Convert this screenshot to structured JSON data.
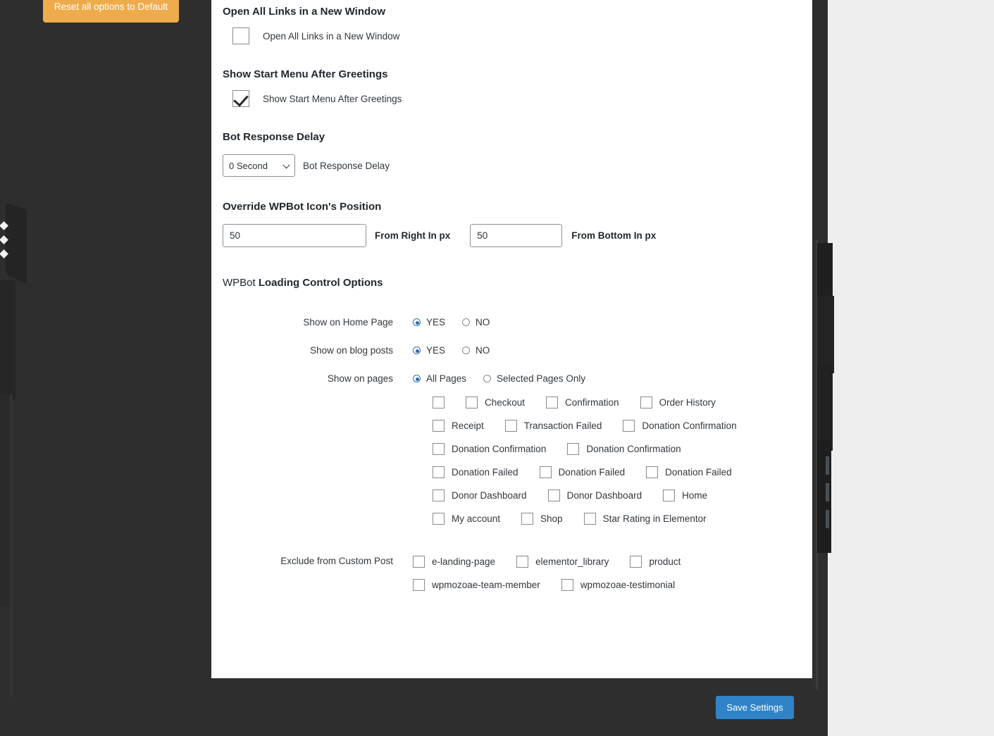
{
  "buttons": {
    "reset_label": "Reset all options to Default",
    "save_label": "Save Settings",
    "reset_color": "#eeab4b",
    "save_color": "#3183c8"
  },
  "sections": {
    "open_links": {
      "heading": "Open All Links in a New Window",
      "checkbox_label": "Open All Links in a New Window",
      "checked": false
    },
    "start_menu": {
      "heading": "Show Start Menu After Greetings",
      "checkbox_label": "Show Start Menu After Greetings",
      "checked": true
    },
    "bot_delay": {
      "heading": "Bot Response Delay",
      "selected_value": "0 Second",
      "after_label": "Bot Response Delay"
    },
    "icon_position": {
      "heading": "Override WPBot Icon's Position",
      "right_value": "50",
      "right_caption": "From Right In px",
      "bottom_value": "50",
      "bottom_caption": "From Bottom In px"
    },
    "loading_control": {
      "heading_light": "WPBot ",
      "heading_bold": "Loading Control Options",
      "rows": [
        {
          "label": "Show on Home Page",
          "options": [
            {
              "text": "YES",
              "selected": true
            },
            {
              "text": "NO",
              "selected": false
            }
          ]
        },
        {
          "label": "Show on blog posts",
          "options": [
            {
              "text": "YES",
              "selected": true
            },
            {
              "text": "NO",
              "selected": false
            }
          ]
        },
        {
          "label": "Show on pages",
          "options": [
            {
              "text": "All Pages",
              "selected": true
            },
            {
              "text": "Selected Pages Only",
              "selected": false
            }
          ]
        }
      ],
      "page_checkbox_lines": [
        [
          {
            "label": "",
            "checked": false
          },
          {
            "label": "Checkout",
            "checked": false
          },
          {
            "label": "Confirmation",
            "checked": false
          },
          {
            "label": "Order History",
            "checked": false
          }
        ],
        [
          {
            "label": "Receipt",
            "checked": false
          },
          {
            "label": "Transaction Failed",
            "checked": false
          },
          {
            "label": "Donation Confirmation",
            "checked": false
          }
        ],
        [
          {
            "label": "Donation Confirmation",
            "checked": false
          },
          {
            "label": "Donation Confirmation",
            "checked": false
          }
        ],
        [
          {
            "label": "Donation Failed",
            "checked": false
          },
          {
            "label": "Donation Failed",
            "checked": false
          },
          {
            "label": "Donation Failed",
            "checked": false
          }
        ],
        [
          {
            "label": "Donor Dashboard",
            "checked": false
          },
          {
            "label": "Donor Dashboard",
            "checked": false
          },
          {
            "label": "Home",
            "checked": false
          }
        ],
        [
          {
            "label": "My account",
            "checked": false
          },
          {
            "label": "Shop",
            "checked": false
          },
          {
            "label": "Star Rating in Elementor",
            "checked": false
          }
        ]
      ],
      "custom_post": {
        "label": "Exclude from Custom Post",
        "lines": [
          [
            {
              "label": "e-landing-page",
              "checked": false
            },
            {
              "label": "elementor_library",
              "checked": false
            },
            {
              "label": "product",
              "checked": false
            }
          ],
          [
            {
              "label": "wpmozoae-team-member",
              "checked": false
            },
            {
              "label": "wpmozoae-testimonial",
              "checked": false
            }
          ]
        ]
      }
    }
  }
}
